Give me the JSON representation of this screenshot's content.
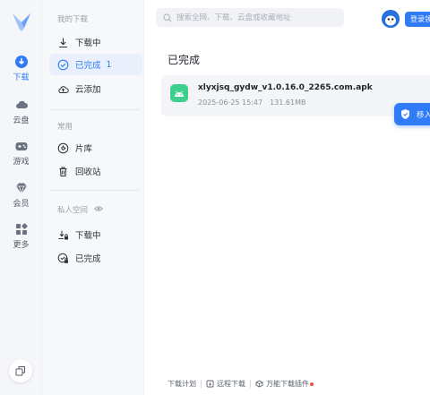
{
  "rail": {
    "items": [
      {
        "label": "下载"
      },
      {
        "label": "云盘"
      },
      {
        "label": "游戏"
      },
      {
        "label": "会员"
      },
      {
        "label": "更多"
      }
    ]
  },
  "sidebar": {
    "section_downloads": "我的下载",
    "downloading": "下载中",
    "completed": "已完成",
    "completed_count": "1",
    "cloud_add": "云添加",
    "section_common": "常用",
    "library": "片库",
    "recycle": "回收站",
    "section_private": "私人空间",
    "private_downloading": "下载中",
    "private_completed": "已完成"
  },
  "search": {
    "placeholder": "搜索全网、下载、云盘或收藏地址"
  },
  "header": {
    "login_label": "登录领"
  },
  "main": {
    "title": "已完成",
    "files": [
      {
        "name": "xlyxjsq_gydw_v1.0.16.0_2265.com.apk",
        "date": "2025-06-25 15:47",
        "size": "131.61MB"
      }
    ],
    "move_label": "移入"
  },
  "footer": {
    "plan": "下载计划",
    "remote": "远程下载",
    "plugin": "万能下载插件"
  },
  "colors": {
    "accent": "#2f7cf6",
    "app_icon": "#3ecf8e",
    "notification_dot": "#f24b4b"
  }
}
